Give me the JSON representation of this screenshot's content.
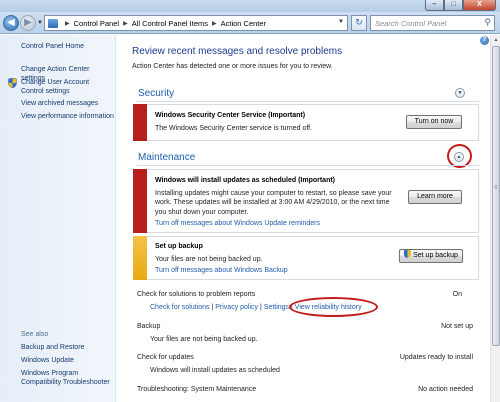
{
  "window": {
    "controls": {
      "minimize": "–",
      "maximize": "□",
      "close": "X"
    }
  },
  "address": {
    "crumbs": [
      "Control Panel",
      "All Control Panel Items",
      "Action Center"
    ],
    "search_placeholder": "Search Control Panel"
  },
  "sidebar": {
    "home": "Control Panel Home",
    "items": [
      "Change Action Center settings",
      "Change User Account Control settings",
      "View archived messages",
      "View performance information"
    ],
    "see_also_title": "See also",
    "see_also": [
      "Backup and Restore",
      "Windows Update",
      "Windows Program Compatibility Troubleshooter"
    ]
  },
  "main": {
    "title": "Review recent messages and resolve problems",
    "subtitle": "Action Center has detected one or more issues for you to review.",
    "security": {
      "title": "Security",
      "alert_title": "Windows Security Center Service  (Important)",
      "alert_text": "The Windows Security Center service is turned off.",
      "button": "Turn on now"
    },
    "maintenance": {
      "title": "Maintenance",
      "update_alert": {
        "title": "Windows will install updates as scheduled  (Important)",
        "text": "Installing updates might cause your computer to restart, so please save your work. These updates will be installed at 3:00 AM 4/29/2010, or the next time you shut down your computer.",
        "link": "Turn off messages about Windows Update reminders",
        "button": "Learn more"
      },
      "backup_alert": {
        "title": "Set up backup",
        "text": "Your files are not being backed up.",
        "link": "Turn off messages about Windows Backup",
        "button": "Set up backup"
      },
      "problem_reports": {
        "label": "Check for solutions to problem reports",
        "status": "On",
        "links": [
          "Check for solutions",
          "Privacy policy",
          "Settings",
          "View reliability history"
        ]
      },
      "backup": {
        "label": "Backup",
        "status": "Not set up",
        "detail": "Your files are not being backed up."
      },
      "updates": {
        "label": "Check for updates",
        "status": "Updates ready to install",
        "detail": "Windows will install updates as scheduled"
      },
      "troubleshooting": {
        "label": "Troubleshooting: System Maintenance",
        "status": "No action needed"
      }
    }
  },
  "colors": {
    "critical": "#b71f1c",
    "warning": "#e9a90f",
    "link": "#1f5dae",
    "heading": "#1e3a8c",
    "annotation": "#c11b17"
  }
}
